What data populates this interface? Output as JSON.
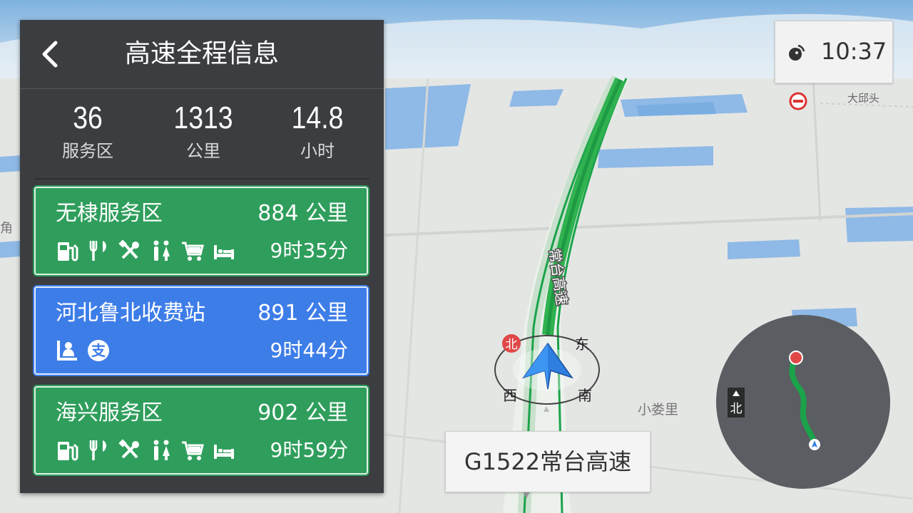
{
  "panel": {
    "title": "高速全程信息",
    "stats": [
      {
        "value": "36",
        "unit": "服务区"
      },
      {
        "value": "1313",
        "unit": "公里"
      },
      {
        "value": "14.8",
        "unit": "小时"
      }
    ],
    "cards": [
      {
        "name": "无棣服务区",
        "distance": "884 公里",
        "time": "9时35分",
        "color": "#2f9e5c",
        "icons": [
          "fuel-icon",
          "restaurant-icon",
          "repair-icon",
          "restroom-icon",
          "shopping-cart-icon",
          "hotel-bed-icon"
        ]
      },
      {
        "name": "河北鲁北收费站",
        "distance": "891 公里",
        "time": "9时44分",
        "color": "#3d7de8",
        "icons": [
          "toll-icon",
          "alipay-icon"
        ]
      },
      {
        "name": "海兴服务区",
        "distance": "902 公里",
        "time": "9时59分",
        "color": "#2f9e5c",
        "icons": [
          "fuel-icon",
          "restaurant-icon",
          "repair-icon",
          "restroom-icon",
          "shopping-cart-icon",
          "hotel-bed-icon"
        ]
      }
    ]
  },
  "status": {
    "time": "10:37",
    "gps_icon": "satellite-icon"
  },
  "map": {
    "current_road": "G1522常台高速",
    "road_name_vertical": "常台高速",
    "place_labels": {
      "top_right": "大邱头",
      "right": "小娄里",
      "left_edge": "角"
    },
    "compass": {
      "north": "北",
      "east": "东",
      "south": "南",
      "west": "西"
    },
    "minimap_north": "北"
  },
  "colors": {
    "route": "#1aa34a",
    "panel": "#3b3d40",
    "service_card": "#2f9e5c",
    "toll_card": "#3d7de8"
  }
}
